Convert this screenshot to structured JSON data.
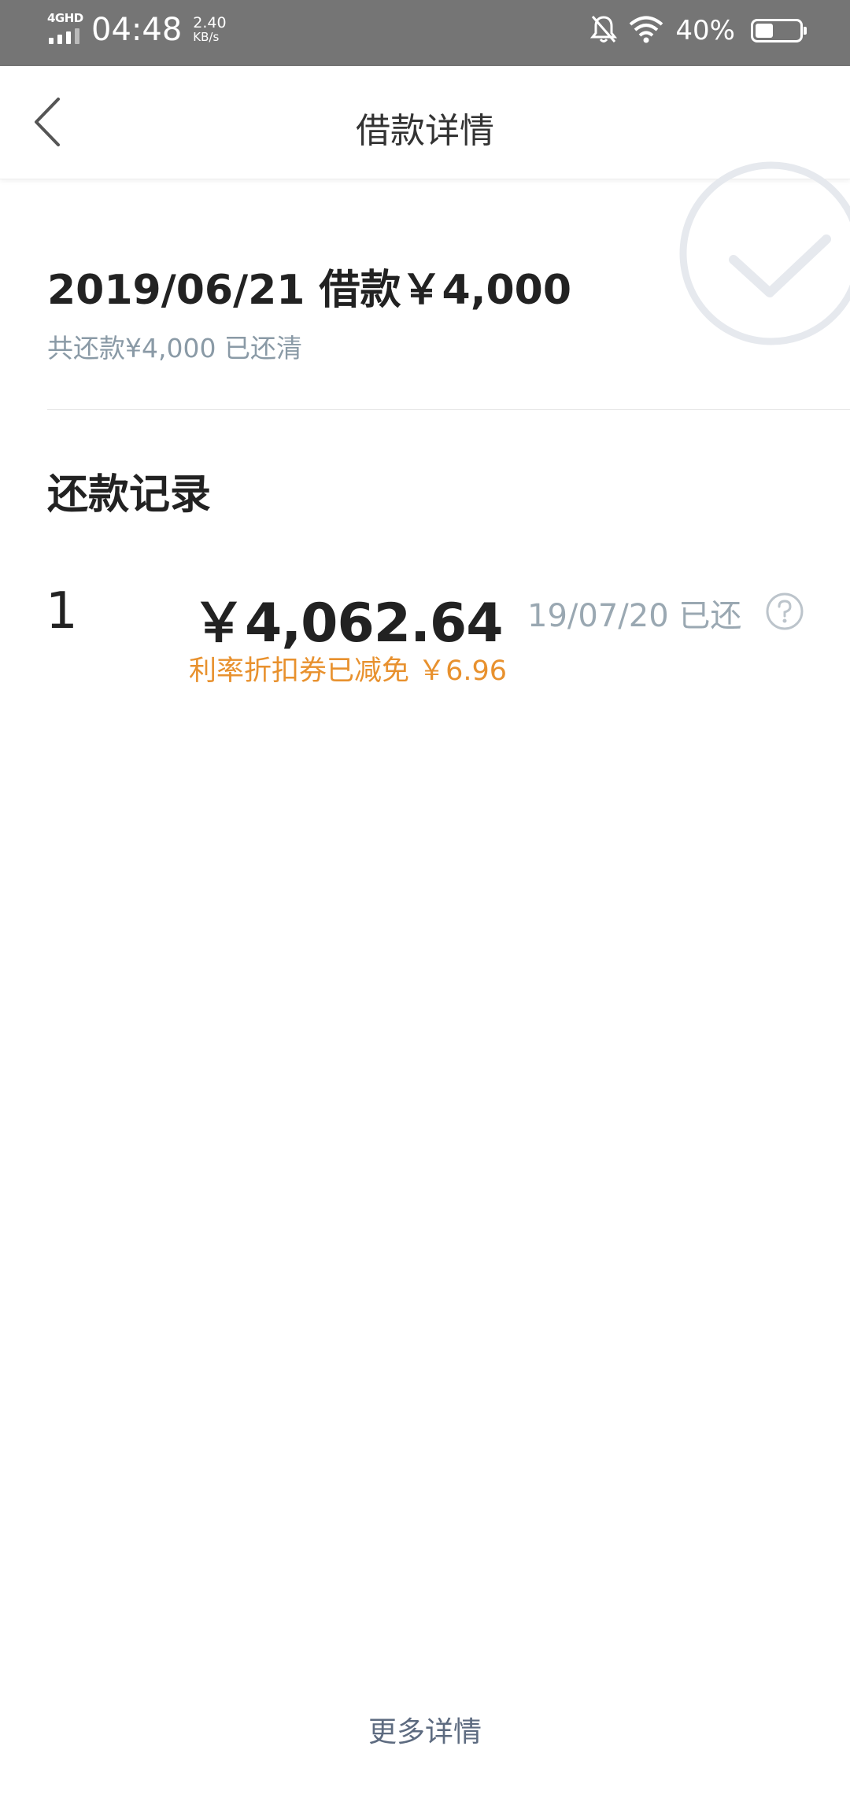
{
  "status_bar": {
    "network": "4GHD",
    "time": "04:48",
    "speed_value": "2.40",
    "speed_unit": "KB/s",
    "battery_percent": "40%",
    "battery_level": 0.4
  },
  "header": {
    "title": "借款详情"
  },
  "loan": {
    "title": "2019/06/21 借款￥4,000",
    "subtitle": "共还款¥4,000 已还清"
  },
  "records": {
    "section_title": "还款记录",
    "items": [
      {
        "index": "1",
        "amount": "￥4,062.64",
        "date": "19/07/20 已还",
        "discount": "利率折扣券已减免 ￥6.96"
      }
    ]
  },
  "footer": {
    "more_label": "更多详情"
  },
  "colors": {
    "status_bar_bg": "#757575",
    "accent_orange": "#e8912e",
    "muted_text": "#9aa8b2",
    "link_text": "#5d6b80"
  }
}
